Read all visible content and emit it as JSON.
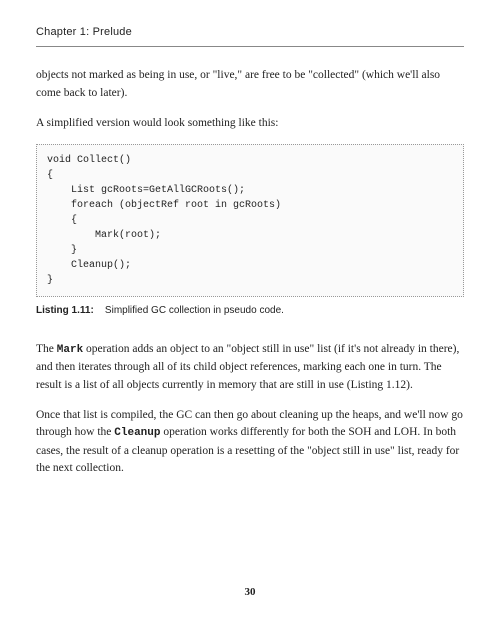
{
  "header": {
    "chapter": "Chapter 1: Prelude"
  },
  "p1": "objects not marked as being in use, or \"live,\" are free to be \"collected\" (which we'll also come back to later).",
  "p2": "A simplified version would look something like this:",
  "code": "void Collect()\n{\n    List gcRoots=GetAllGCRoots();\n    foreach (objectRef root in gcRoots)\n    {\n        Mark(root);\n    }\n    Cleanup();\n}",
  "listing": {
    "label": "Listing 1.11:",
    "caption": "Simplified GC collection in pseudo code."
  },
  "p3a": "The ",
  "p3_mark": "Mark",
  "p3b": " operation adds an object to an \"object still in use\" list (if it's not already in there), and then iterates through all of its child object references, marking each one in turn. The result is a list of all objects currently in memory that are still in use (Listing 1.12).",
  "p4a": "Once that list is compiled, the GC can then go about cleaning up the heaps, and we'll now go through how the ",
  "p4_cleanup": "Cleanup",
  "p4b": " operation works differently for both the SOH and LOH. In both cases, the result of a cleanup operation is a resetting of the \"object still in use\" list, ready for the next collection.",
  "page": "30"
}
